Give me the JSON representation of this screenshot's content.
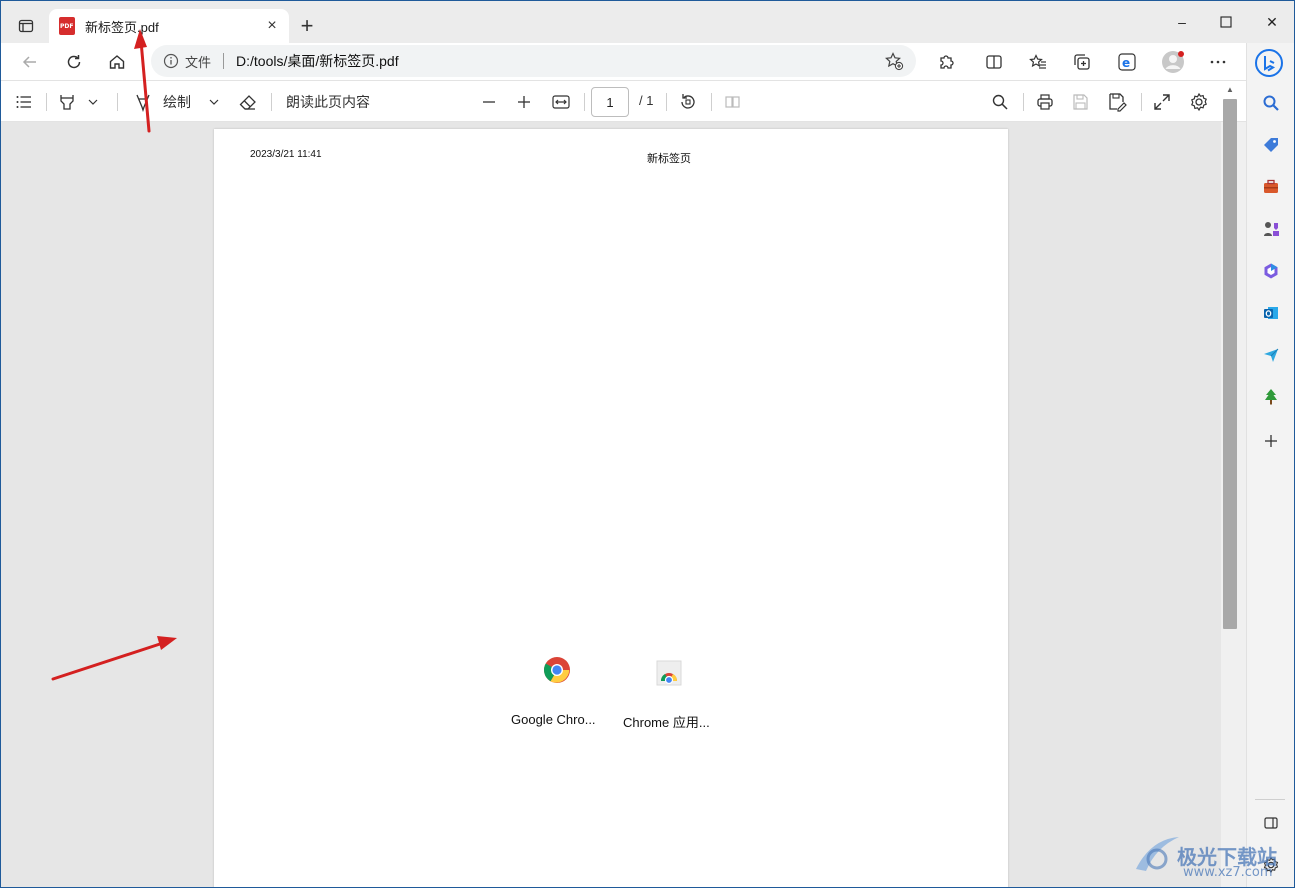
{
  "tab": {
    "title": "新标签页.pdf",
    "close_label": "×",
    "new_tab_label": "+"
  },
  "window_controls": {
    "minimize": "–",
    "maximize": "☐",
    "close": "✕"
  },
  "address": {
    "info_label": "文件",
    "url": "D:/tools/桌面/新标签页.pdf"
  },
  "pdf_toolbar": {
    "draw_label": "绘制",
    "read_aloud_label": "朗读此页内容",
    "current_page": "1",
    "total_pages": "/ 1"
  },
  "document": {
    "date": "2023/3/21 11:41",
    "header_title": "新标签页",
    "apps": [
      {
        "label": "Google Chro...",
        "icon": "chrome-icon"
      },
      {
        "label": "Chrome 应用...",
        "icon": "chrome-apps-icon"
      }
    ]
  },
  "sidebar": {
    "items": [
      "bing-icon",
      "search-icon",
      "shopping-tag-icon",
      "toolbox-icon",
      "games-icon",
      "microsoft-365-icon",
      "outlook-icon",
      "send-icon",
      "tree-icon",
      "add-icon"
    ]
  },
  "watermark": {
    "name": "极光下载站",
    "url": "www.xz7.com"
  },
  "colors": {
    "accent": "#1a73e8",
    "annotation_red": "#d42020",
    "pdf_red": "#d62d2d"
  }
}
